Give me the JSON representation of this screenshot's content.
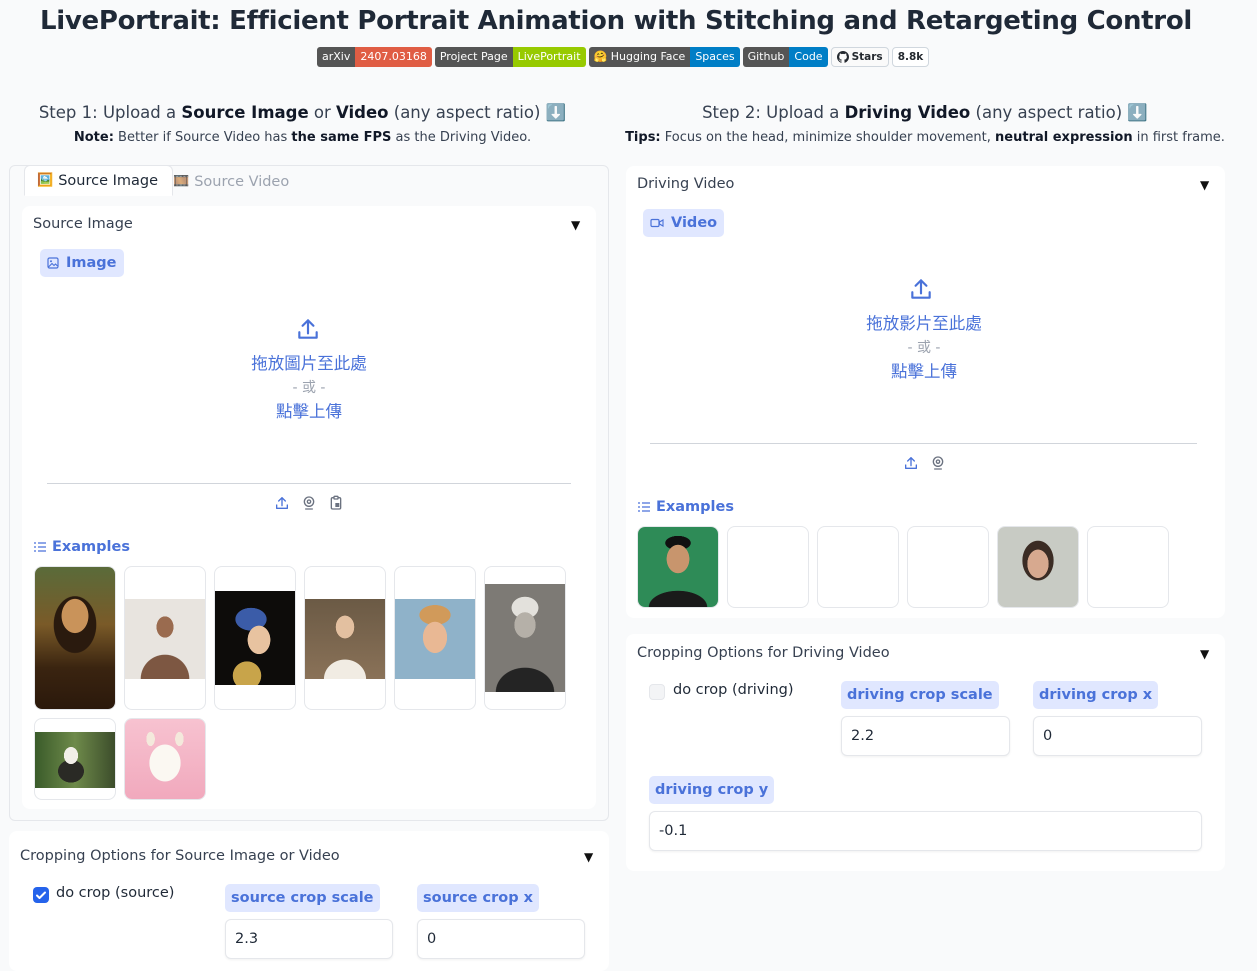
{
  "header": {
    "title": "LivePortrait: Efficient Portrait Animation with Stitching and Retargeting Control"
  },
  "badges": [
    {
      "left": "arXiv",
      "right": "2407.03168",
      "color": "#e05d44"
    },
    {
      "left": "Project Page",
      "right": "LivePortrait",
      "color": "#97ca00"
    },
    {
      "left": "🤗 Hugging Face",
      "right": "Spaces",
      "color": "#007ec6"
    },
    {
      "left": "Github",
      "right": "Code",
      "color": "#007ec6"
    }
  ],
  "github": {
    "stars_label": "Stars",
    "stars_count": "8.8k"
  },
  "step1": {
    "prefix": "Step 1: Upload a ",
    "b1": "Source Image",
    "mid": " or ",
    "b2": "Video",
    "suffix": " (any aspect ratio) ⬇️",
    "note_label": "Note:",
    "note_a": " Better if Source Video has ",
    "note_b": "the same FPS",
    "note_c": " as the Driving Video."
  },
  "step2": {
    "prefix": "Step 2: Upload a ",
    "b1": "Driving Video",
    "suffix": " (any aspect ratio) ⬇️",
    "tips_label": "Tips:",
    "tips_a": " Focus on the head, minimize shoulder movement, ",
    "tips_b": "neutral expression",
    "tips_c": " in first frame."
  },
  "tabs": [
    {
      "label": "Source Image",
      "icon": "🖼️"
    },
    {
      "label": "Source Video",
      "icon": "🎞️"
    }
  ],
  "source_image": {
    "header": "Source Image",
    "chip": "Image",
    "drop": "拖放圖片至此處",
    "or": "- 或 -",
    "click": "點擊上傳",
    "examples": "Examples"
  },
  "driving_video": {
    "header": "Driving Video",
    "chip": "Video",
    "drop": "拖放影片至此處",
    "or": "- 或 -",
    "click": "點擊上傳",
    "examples": "Examples"
  },
  "crop_source": {
    "header": "Cropping Options for Source Image or Video",
    "checkbox": "do crop (source)",
    "checked": true,
    "scale_label": "source crop scale",
    "scale_value": "2.3",
    "x_label": "source crop x",
    "x_value": "0"
  },
  "crop_driving": {
    "header": "Cropping Options for Driving Video",
    "checkbox": "do crop (driving)",
    "checked": false,
    "scale_label": "driving crop scale",
    "scale_value": "2.2",
    "x_label": "driving crop x",
    "x_value": "0",
    "y_label": "driving crop y",
    "y_value": "-0.1"
  },
  "colors": {
    "accent": "#4a72d9",
    "chip_bg": "#e0e7ff",
    "checkbox": "#2563eb"
  }
}
